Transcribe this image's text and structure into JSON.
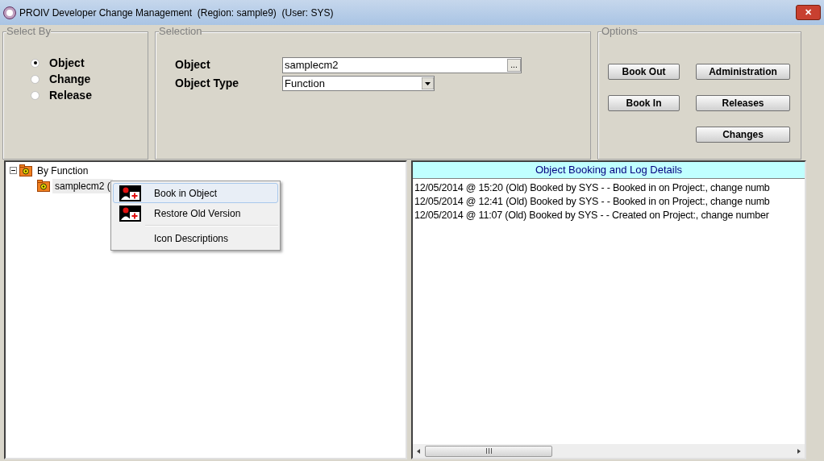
{
  "window": {
    "title": "PROIV Developer Change Management  (Region: sample9)  (User: SYS)",
    "close": "✕"
  },
  "select_by": {
    "title": "Select By",
    "options": [
      {
        "label": "Object",
        "selected": true
      },
      {
        "label": "Change",
        "selected": false
      },
      {
        "label": "Release",
        "selected": false
      }
    ]
  },
  "selection": {
    "title": "Selection",
    "object_label": "Object",
    "object_value": "samplecm2",
    "browse": "...",
    "type_label": "Object Type",
    "type_value": "Function"
  },
  "options": {
    "title": "Options",
    "columns": [
      [
        "Book Out",
        "Book In"
      ],
      [
        "Administration",
        "Releases",
        "Changes"
      ]
    ]
  },
  "tree": [
    {
      "label": "By Function",
      "expanded": true,
      "children": [
        {
          "label": "samplecm2 (",
          "selected": true
        }
      ]
    }
  ],
  "context_menu": [
    {
      "label": "Book in Object",
      "kind": "icon",
      "selected": true,
      "separator_before": false
    },
    {
      "label": "Restore Old Version",
      "kind": "icon",
      "selected": false,
      "separator_before": false
    },
    {
      "label": "Icon Descriptions",
      "kind": "plain",
      "selected": false,
      "separator_before": true
    }
  ],
  "log": {
    "title": "Object Booking and Log Details",
    "lines": [
      "12/05/2014 @ 15:20 (Old) Booked by SYS - - Booked in on Project:, change numb",
      "12/05/2014 @ 12:41 (Old) Booked by SYS - - Booked in on Project:, change numb",
      "12/05/2014 @ 11:07 (Old) Booked by SYS - - Created on Project:, change number"
    ]
  }
}
